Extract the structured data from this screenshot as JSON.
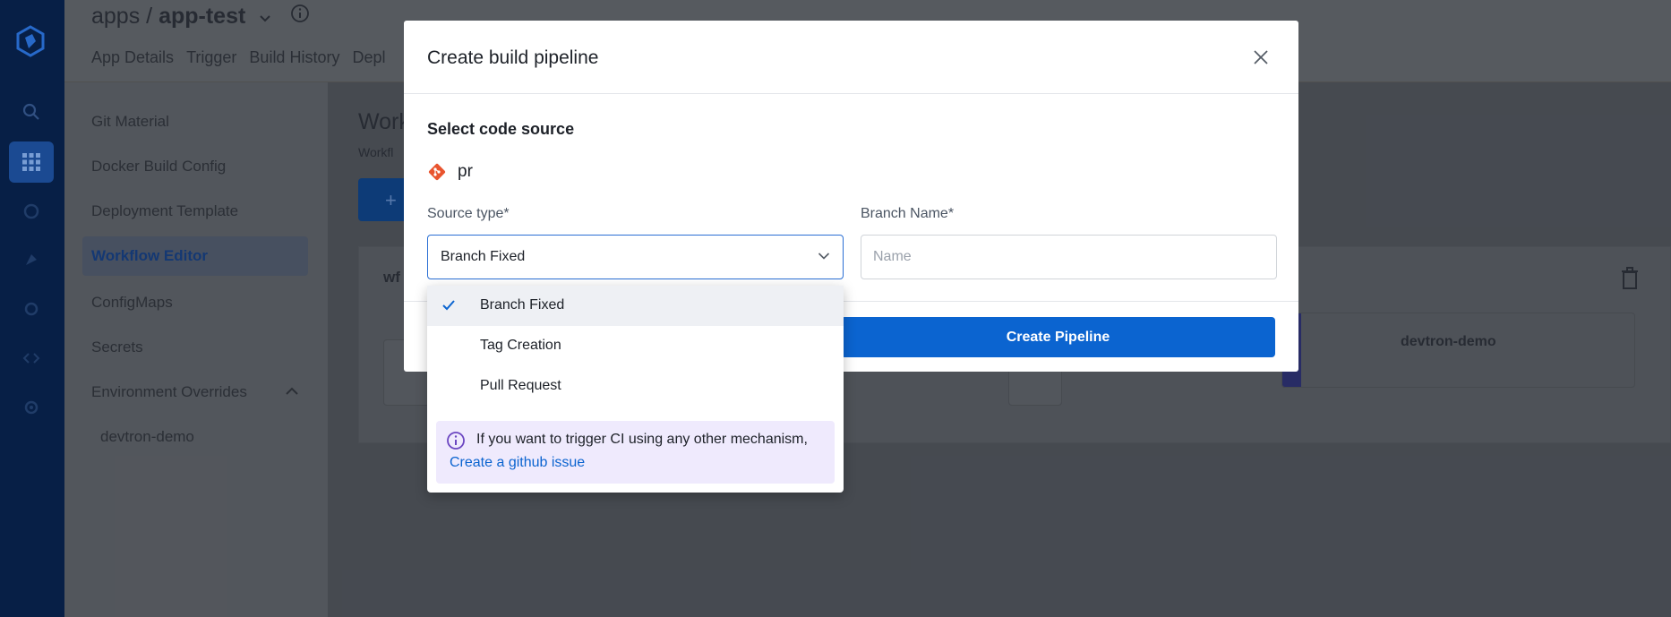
{
  "app": {
    "breadcrumb_parent": "apps",
    "breadcrumb_sep": " / ",
    "app_name": "app-test",
    "tabs": [
      "App Details",
      "Trigger",
      "Build History",
      "Depl"
    ],
    "side_nav": [
      {
        "label": "Git Material"
      },
      {
        "label": "Docker Build Config"
      },
      {
        "label": "Deployment Template"
      },
      {
        "label": "Workflow Editor",
        "active": true
      },
      {
        "label": "ConfigMaps"
      },
      {
        "label": "Secrets"
      },
      {
        "label": "Environment Overrides"
      },
      {
        "label": "devtron-demo"
      }
    ],
    "main_title": "Work",
    "main_sub": "Workfl",
    "workflow_name": "wf",
    "env_node": "devtron-demo"
  },
  "modal": {
    "title": "Create build pipeline",
    "section_title": "Select code source",
    "git_material": "pr",
    "source_type_label": "Source type*",
    "source_type_value": "Branch Fixed",
    "branch_label": "Branch Name*",
    "branch_placeholder": "Name",
    "branch_value": "",
    "create_button": "Create Pipeline"
  },
  "dropdown": {
    "options": [
      {
        "label": "Branch Fixed",
        "selected": true
      },
      {
        "label": "Tag Creation",
        "selected": false
      },
      {
        "label": "Pull Request",
        "selected": false
      }
    ],
    "info_text": "If you want to trigger CI using any other mechanism,",
    "info_link": "Create a github issue"
  },
  "colors": {
    "primary": "#0b64d0",
    "git_icon": "#e9542e",
    "info_bg": "#efeafd",
    "info_icon": "#6b46c1"
  },
  "icons": [
    "devtron-logo-icon",
    "search-icon",
    "apps-grid-icon",
    "chevron-down-icon",
    "info-icon",
    "close-icon",
    "git-icon",
    "check-icon",
    "delete-icon"
  ]
}
